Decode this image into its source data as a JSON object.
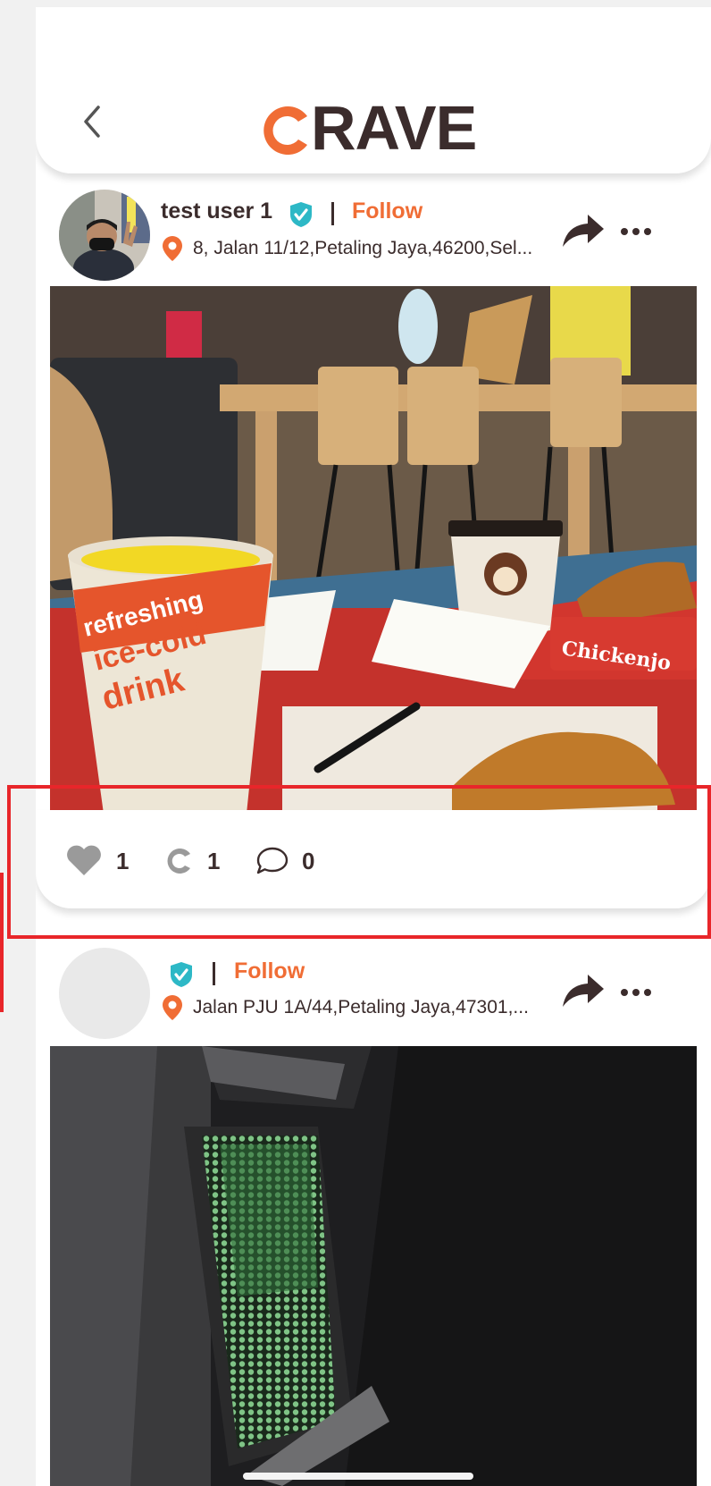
{
  "app": {
    "logo_text": "RAVE",
    "brand_color": "#f06d35",
    "dark_color": "#3b2c2c"
  },
  "header": {
    "back_icon": "chevron-left-icon"
  },
  "posts": [
    {
      "username": "test user 1",
      "verified": true,
      "follow_label": "Follow",
      "address": "8, Jalan 11/12,Petaling Jaya,46200,Sel...",
      "photo_texts": {
        "cup_line1": "refreshing",
        "cup_line2": "ice-cold",
        "cup_line3": "drink",
        "box_text": "Chickenjo"
      },
      "likes": "1",
      "craves": "1",
      "comments": "0"
    },
    {
      "username": "",
      "verified": true,
      "follow_label": "Follow",
      "address": "Jalan PJU 1A/44,Petaling Jaya,47301,..."
    }
  ],
  "highlight_color": "#e8262a"
}
